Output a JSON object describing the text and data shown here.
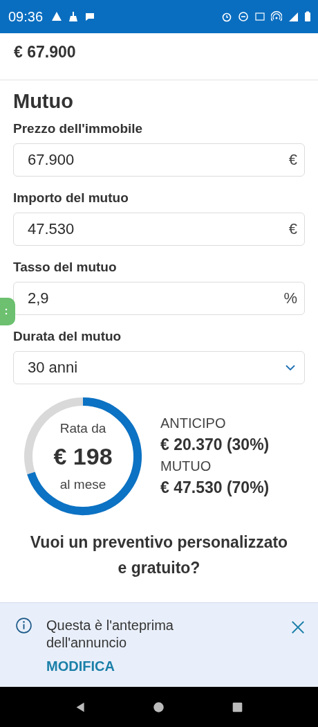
{
  "status_bar": {
    "time": "09:36"
  },
  "header": {
    "price": "€ 67.900"
  },
  "section": {
    "title": "Mutuo"
  },
  "fields": [
    {
      "kind": "input",
      "label": "Prezzo dell'immobile",
      "value": "67.900",
      "unit": "€"
    },
    {
      "kind": "input",
      "label": "Importo del mutuo",
      "value": "47.530",
      "unit": "€"
    },
    {
      "kind": "input",
      "label": "Tasso del mutuo",
      "value": "2,9",
      "unit": "%"
    },
    {
      "kind": "select",
      "label": "Durata del mutuo",
      "value": "30 anni"
    }
  ],
  "summary": {
    "caption_top": "Rata da",
    "amount": "€ 198",
    "caption_bottom": "al mese",
    "items": [
      {
        "label": "ANTICIPO",
        "value": "€ 20.370 (30%)"
      },
      {
        "label": "MUTUO",
        "value": "€ 47.530 (70%)"
      }
    ]
  },
  "question": "Vuoi un preventivo personalizzato e gratuito?",
  "banner": {
    "message": "Questa è l'anteprima dell'annuncio",
    "action": "MODIFICA"
  }
}
